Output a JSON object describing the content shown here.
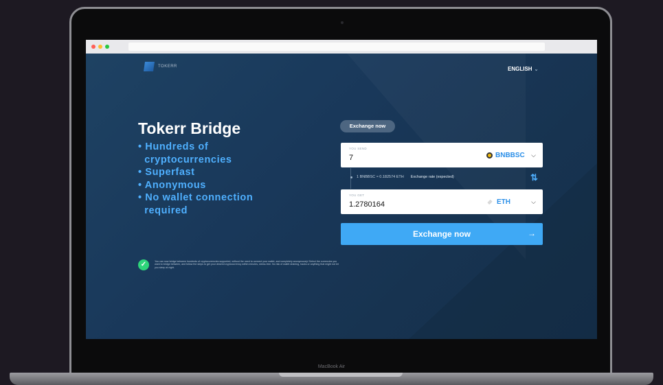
{
  "device": {
    "label": "MacBook Air"
  },
  "header": {
    "logo_text": "TOKERR",
    "language": "ENGLISH"
  },
  "hero": {
    "title": "Tokerr Bridge",
    "features": [
      "• Hundreds of",
      "  cryptocurrencies",
      "• Superfast",
      "• Anonymous",
      "• No wallet connection",
      "  required"
    ],
    "disclaimer": "You can now bridge between hundreds of cryptocurrencies supported, without the need to connect your wallet, and completely anonymously! Select the currencies you want to bridge between, and follow the steps to get your desired cryptocurrency within minutes, stress-free. No risk of wallet draining, hacks or anything that might not let you sleep at night."
  },
  "exchange": {
    "tab_label": "Exchange now",
    "send": {
      "label": "YOU SEND",
      "value": "7",
      "currency": "BNBBSC"
    },
    "get": {
      "label": "YOU GET",
      "value": "1.2780164",
      "currency": "ETH"
    },
    "rate_text": "1 BNBBSC ≈ 0.182574 ETH",
    "rate_label": "Exchange rate (expected)",
    "button_label": "Exchange now"
  },
  "colors": {
    "accent": "#3fa9f5",
    "feature_text": "#4fb0ff",
    "background": "#17324a",
    "success": "#2ed47a"
  },
  "icons": {
    "swap": "swap-vertical-icon",
    "arrow": "arrow-right-icon",
    "check": "check-icon"
  }
}
